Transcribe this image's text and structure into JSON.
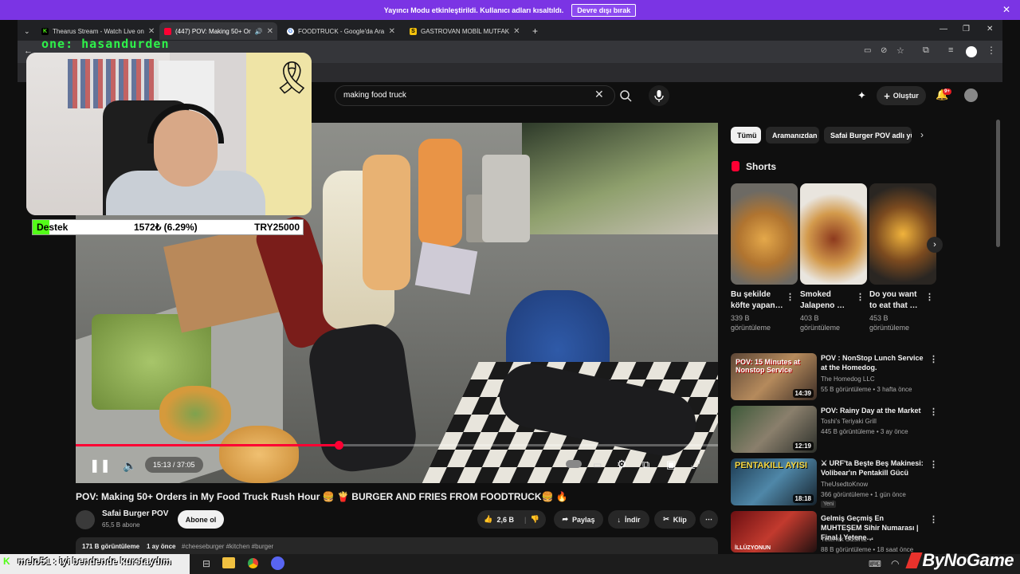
{
  "notice": {
    "text": "Yayıncı Modu etkinleştirildi. Kullanıcı adları kısaltıldı.",
    "button": "Devre dışı bırak"
  },
  "tabs": [
    {
      "title": "Thearus Stream - Watch Live on",
      "favicon_color": "#53fc18",
      "favicon_glyph": "K"
    },
    {
      "title": "(447) POV: Making 50+ Or",
      "favicon_color": "#ff0033",
      "favicon_glyph": ""
    },
    {
      "title": "FOODTRUCK - Google'da Ara",
      "favicon_color": "#4285f4",
      "favicon_glyph": "G"
    },
    {
      "title": "GASTROVAN MOBİL MUTFAK",
      "favicon_color": "#f4c20d",
      "favicon_glyph": "S"
    }
  ],
  "youtube": {
    "search_value": "making food truck",
    "create_label": "Oluştur",
    "notification_badge": "9+"
  },
  "webcam": {
    "name": "one: hasandurden"
  },
  "donation": {
    "label": "Destek",
    "amount": "1572₺ (6.29%)",
    "goal": "TRY25000",
    "progress_fraction": 0.0629
  },
  "player": {
    "time": "15:13 / 37:05",
    "progress_fraction": 0.41
  },
  "video": {
    "title": "POV: Making 50+ Orders in My Food Truck Rush Hour 🍔 🍟 BURGER AND FRIES FROM FOODTRUCK🍔 🔥",
    "channel": "Safai Burger POV",
    "subscribers": "65,5 B abone",
    "subscribe_label": "Abone ol",
    "likes": "2,6 B",
    "share_label": "Paylaş",
    "download_label": "İndir",
    "clip_label": "Klip",
    "views": "171 B görüntüleme",
    "age": "1 ay önce",
    "tags": "#cheeseburger #kitchen #burger"
  },
  "sidebar": {
    "chips": [
      "Tümü",
      "Aramanızdan",
      "Safai Burger POV adlı yü"
    ],
    "shorts_heading": "Shorts",
    "shorts": [
      {
        "title": "Bu şekilde köfte yapan…",
        "views": "339 B görüntüleme"
      },
      {
        "title": "Smoked Jalapeno …",
        "views": "403 B görüntüleme"
      },
      {
        "title": "Do you want to eat that …",
        "views": "453 B görüntüleme"
      }
    ],
    "related": [
      {
        "title": "POV : NonStop Lunch Service at the Homedog.",
        "channel": "The Homedog LLC",
        "meta": "55 B görüntüleme • 3 hafta önce",
        "duration": "14:39",
        "badge": ""
      },
      {
        "title": "POV: Rainy Day at the Market",
        "channel": "Toshi's Teriyaki Grill",
        "meta": "445 B görüntüleme • 3 ay önce",
        "duration": "12:19",
        "badge": ""
      },
      {
        "title": "⚔ URF'ta Beşte Beş Makinesi: Volibear'ın Pentakill Gücü",
        "channel": "TheUsedtoKnow",
        "meta": "366 görüntüleme • 1 gün önce",
        "duration": "18:18",
        "badge": "Yeni"
      },
      {
        "title": "Gelmiş Geçmiş En MUHTEŞEM Sihir Numarası | Final | Yetene…",
        "channel": "Yetenek Sizsiniz ✓",
        "meta": "88 B görüntüleme • 18 saat önce",
        "duration": "",
        "badge": ""
      }
    ],
    "related_thumb_text": [
      "POV: 15 Minutes at Nonstop Service",
      "",
      "PENTAKILL AYISI",
      "İLLÜZYONUN"
    ]
  },
  "chat": {
    "user": "melo51",
    "message": "iyi bendende kurstaydım"
  },
  "watermark": "ByNoGame",
  "colors": {
    "accent": "#ff0033",
    "notice_bg": "#7b34e4",
    "kick_green": "#53fc18"
  }
}
